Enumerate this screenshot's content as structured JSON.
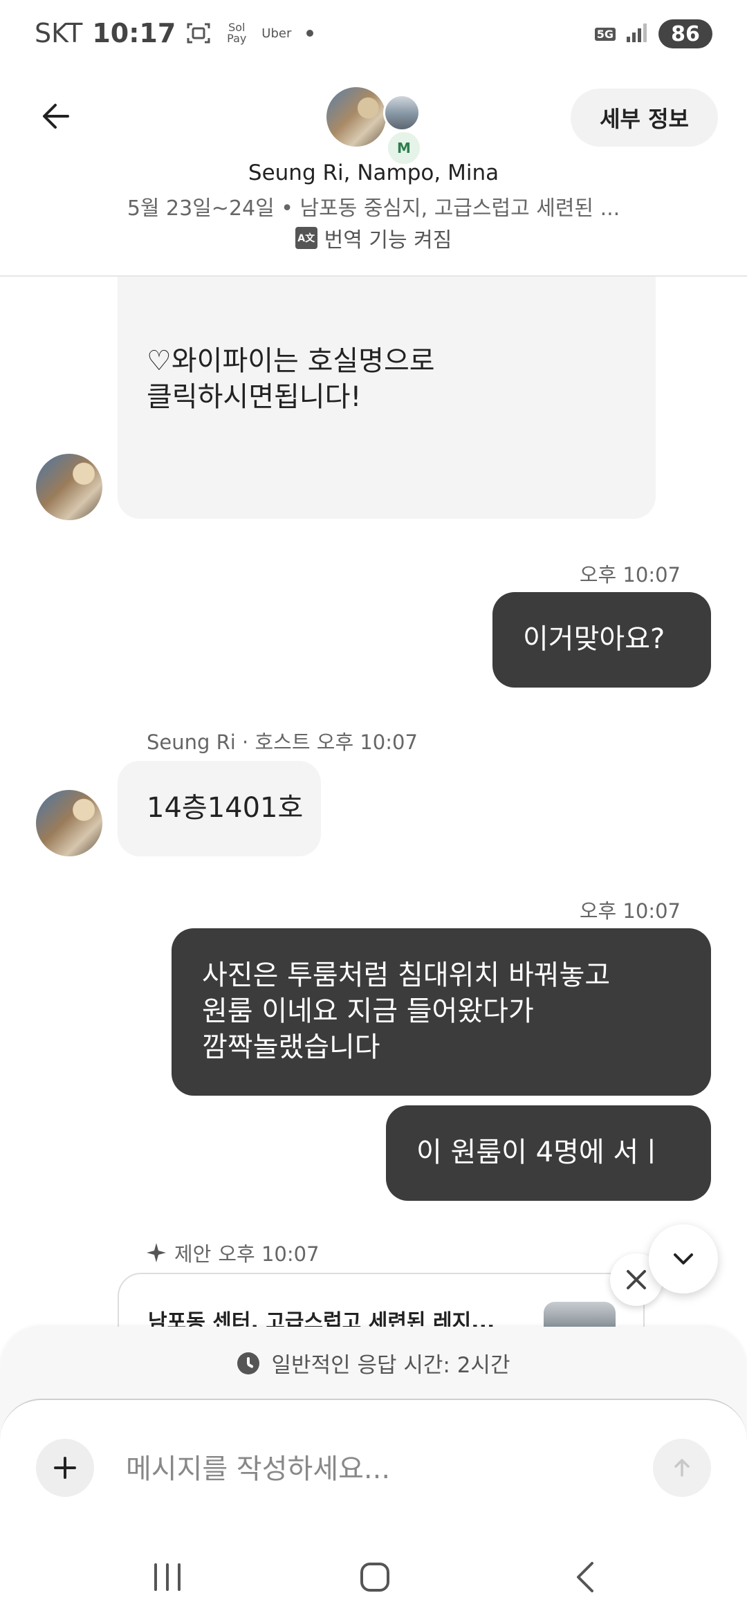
{
  "status_bar": {
    "carrier": "SKT",
    "time": "10:17",
    "sol_pay": "Sol Pay",
    "uber": "Uber",
    "network": "5G",
    "battery": "86"
  },
  "header": {
    "avatar_initial": "M",
    "title": "Seung Ri, Nampo, Mina",
    "subtitle": "5월 23일~24일 • 남포동 중심지, 고급스럽고 세련된 ...",
    "translation": "번역 기능 켜짐",
    "detail_button": "세부 정보"
  },
  "messages": {
    "m1_text": "♡와이파이는 호실명으로\n클릭하시면됩니다!",
    "m2_time": "오후 10:07",
    "m2_text": "이거맞아요?",
    "m3_sender": "Seung Ri · 호스트",
    "m3_time": "오후 10:07",
    "m3_text": "14층1401호",
    "m4_time": "오후 10:07",
    "m4_text": "사진은 투룸처럼 침대위치 바꿔놓고\n원룸 이네요  지금 들어왔다가\n깜짝놀랬습니다",
    "m5_text": "이 원룸이 4명에 서ㅣ"
  },
  "suggestion": {
    "label": "제안",
    "time": "오후 10:07",
    "card_title": "남포동 센터, 고급스럽고 세련된 레지..."
  },
  "composer": {
    "response_time": "일반적인 응답 시간: 2시간",
    "placeholder": "메시지를 작성하세요..."
  }
}
